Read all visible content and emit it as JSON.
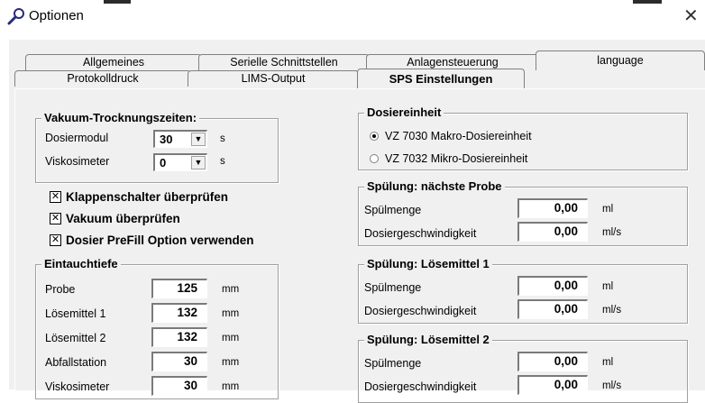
{
  "window": {
    "title": "Optionen",
    "close": "✕",
    "icon": "wrench-icon"
  },
  "tabs": {
    "row_back": [
      "Allgemeines",
      "Serielle Schnittstellen",
      "Anlagensteuerung",
      "language"
    ],
    "row_front": [
      "Protokolldruck",
      "LIMS-Output",
      "SPS Einstellungen"
    ],
    "active": "SPS Einstellungen"
  },
  "vakuum": {
    "title": "Vakuum-Trocknungszeiten:",
    "dosiermodul": {
      "label": "Dosiermodul",
      "value": "30",
      "unit": "s"
    },
    "viskosimeter": {
      "label": "Viskosimeter",
      "value": "0",
      "unit": "s"
    }
  },
  "checks": [
    {
      "label": "Klappenschalter überprüfen",
      "checked": true
    },
    {
      "label": "Vakuum überprüfen",
      "checked": true
    },
    {
      "label": "Dosier PreFill Option verwenden",
      "checked": true
    }
  ],
  "eintauch": {
    "title": "Eintauchtiefe",
    "rows": [
      {
        "label": "Probe",
        "value": "125",
        "unit": "mm"
      },
      {
        "label": "Lösemittel 1",
        "value": "132",
        "unit": "mm"
      },
      {
        "label": "Lösemittel 2",
        "value": "132",
        "unit": "mm"
      },
      {
        "label": "Abfallstation",
        "value": "30",
        "unit": "mm"
      },
      {
        "label": "Viskosimeter",
        "value": "30",
        "unit": "mm"
      }
    ]
  },
  "dosiereinheit": {
    "title": "Dosiereinheit",
    "options": [
      {
        "label": "VZ 7030 Makro-Dosiereinheit",
        "selected": true
      },
      {
        "label": "VZ 7032 Mikro-Dosiereinheit",
        "selected": false
      }
    ]
  },
  "spuelung_probe": {
    "title": "Spülung: nächste Probe",
    "menge": {
      "label": "Spülmenge",
      "value": "0,00",
      "unit": "ml"
    },
    "geschw": {
      "label": "Dosiergeschwindigkeit",
      "value": "0,00",
      "unit": "ml/s"
    }
  },
  "spuelung_lm1": {
    "title": "Spülung: Lösemittel 1",
    "menge": {
      "label": "Spülmenge",
      "value": "0,00",
      "unit": "ml"
    },
    "geschw": {
      "label": "Dosiergeschwindigkeit",
      "value": "0,00",
      "unit": "ml/s"
    }
  },
  "spuelung_lm2": {
    "title": "Spülung: Lösemittel 2",
    "menge": {
      "label": "Spülmenge",
      "value": "0,00",
      "unit": "ml"
    },
    "geschw": {
      "label": "Dosiergeschwindigkeit",
      "value": "0,00",
      "unit": "ml/s"
    }
  }
}
